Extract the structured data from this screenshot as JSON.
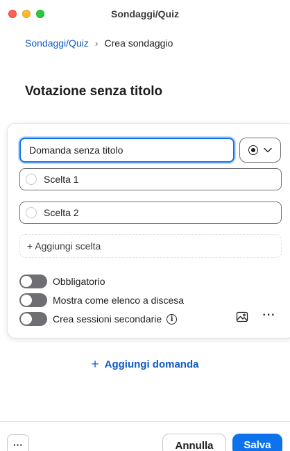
{
  "window": {
    "title": "Sondaggi/Quiz"
  },
  "breadcrumb": {
    "parent": "Sondaggi/Quiz",
    "separator": "›",
    "current": "Crea sondaggio"
  },
  "poll": {
    "title": "Votazione senza titolo"
  },
  "question": {
    "value": "Domanda senza titolo",
    "type_icon": "radio-icon",
    "type_chevron": "⌄",
    "choices": [
      {
        "label": "Scelta 1"
      },
      {
        "label": "Scelta 2"
      }
    ],
    "add_choice_label": "+ Aggiungi scelta",
    "toggles": [
      {
        "label": "Obbligatorio",
        "on": false
      },
      {
        "label": "Mostra come elenco a discesa",
        "on": false
      },
      {
        "label": "Crea sessioni secondarie",
        "on": false
      }
    ],
    "info_glyph": "i",
    "more_glyph": "···"
  },
  "add_question": {
    "plus": "+",
    "label": "Aggiungi domanda"
  },
  "footer": {
    "more_glyph": "···",
    "cancel_label": "Annulla",
    "save_label": "Salva"
  },
  "colors": {
    "accent": "#0e72ed",
    "link": "#0e5bc4",
    "toggle_off": "#6e6e73"
  }
}
